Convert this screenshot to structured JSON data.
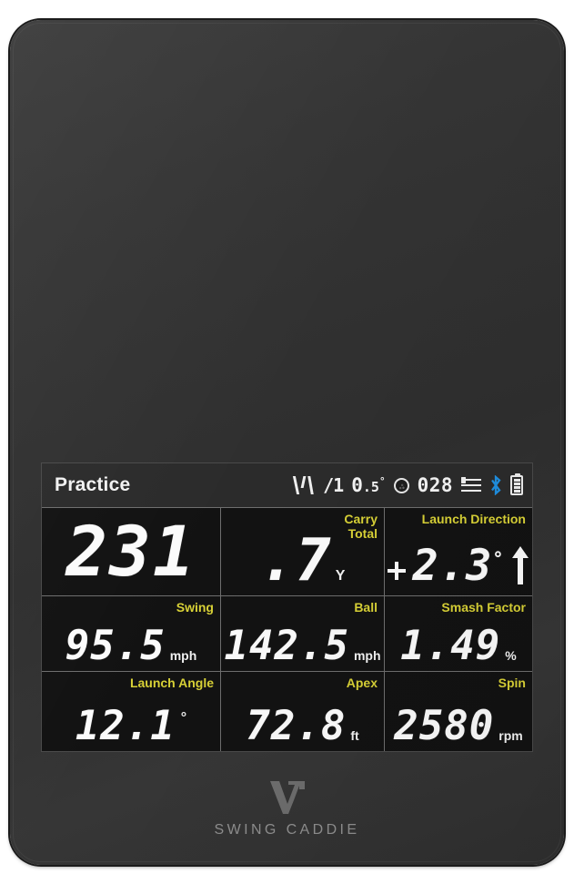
{
  "device": {
    "brand_name": "SWING CADDIE",
    "brand_mark": "vc-logo-icon",
    "body_color": "#333333"
  },
  "screen": {
    "background": "#121212",
    "label_color": "#d8d136",
    "value_color": "#fbfbfb",
    "statusbar": {
      "mode": "Practice",
      "wind_icon": "wind-icon",
      "wind_direction": "/1",
      "wind_value": "0",
      "wind_decimal": ".5",
      "wind_degree": "°",
      "ball_icon": "golf-ball-icon",
      "shot_count": "028",
      "settings_icon": "settings-sliders-icon",
      "bluetooth_icon": "bluetooth-icon",
      "bluetooth_color": "#1f8fe0",
      "battery_icon": "battery-icon"
    },
    "metrics": {
      "carry_total": {
        "label_line1": "Carry",
        "label_line2": "Total",
        "integer": "231",
        "decimal": ".7",
        "unit": "Y"
      },
      "launch_direction": {
        "label": "Launch Direction",
        "value": "2.3",
        "degree": "°",
        "left_icon": "direction-cross-icon",
        "right_icon": "arrow-up-icon"
      },
      "swing": {
        "label": "Swing",
        "value": "95.5",
        "unit": "mph"
      },
      "ball": {
        "label": "Ball",
        "value": "142.5",
        "unit": "mph"
      },
      "smash_factor": {
        "label": "Smash Factor",
        "value": "1.49",
        "unit": "%"
      },
      "launch_angle": {
        "label": "Launch Angle",
        "value": "12.1",
        "unit": "°"
      },
      "apex": {
        "label": "Apex",
        "value": "72.8",
        "unit": "ft"
      },
      "spin": {
        "label": "Spin",
        "value": "2580",
        "unit": "rpm"
      }
    }
  }
}
